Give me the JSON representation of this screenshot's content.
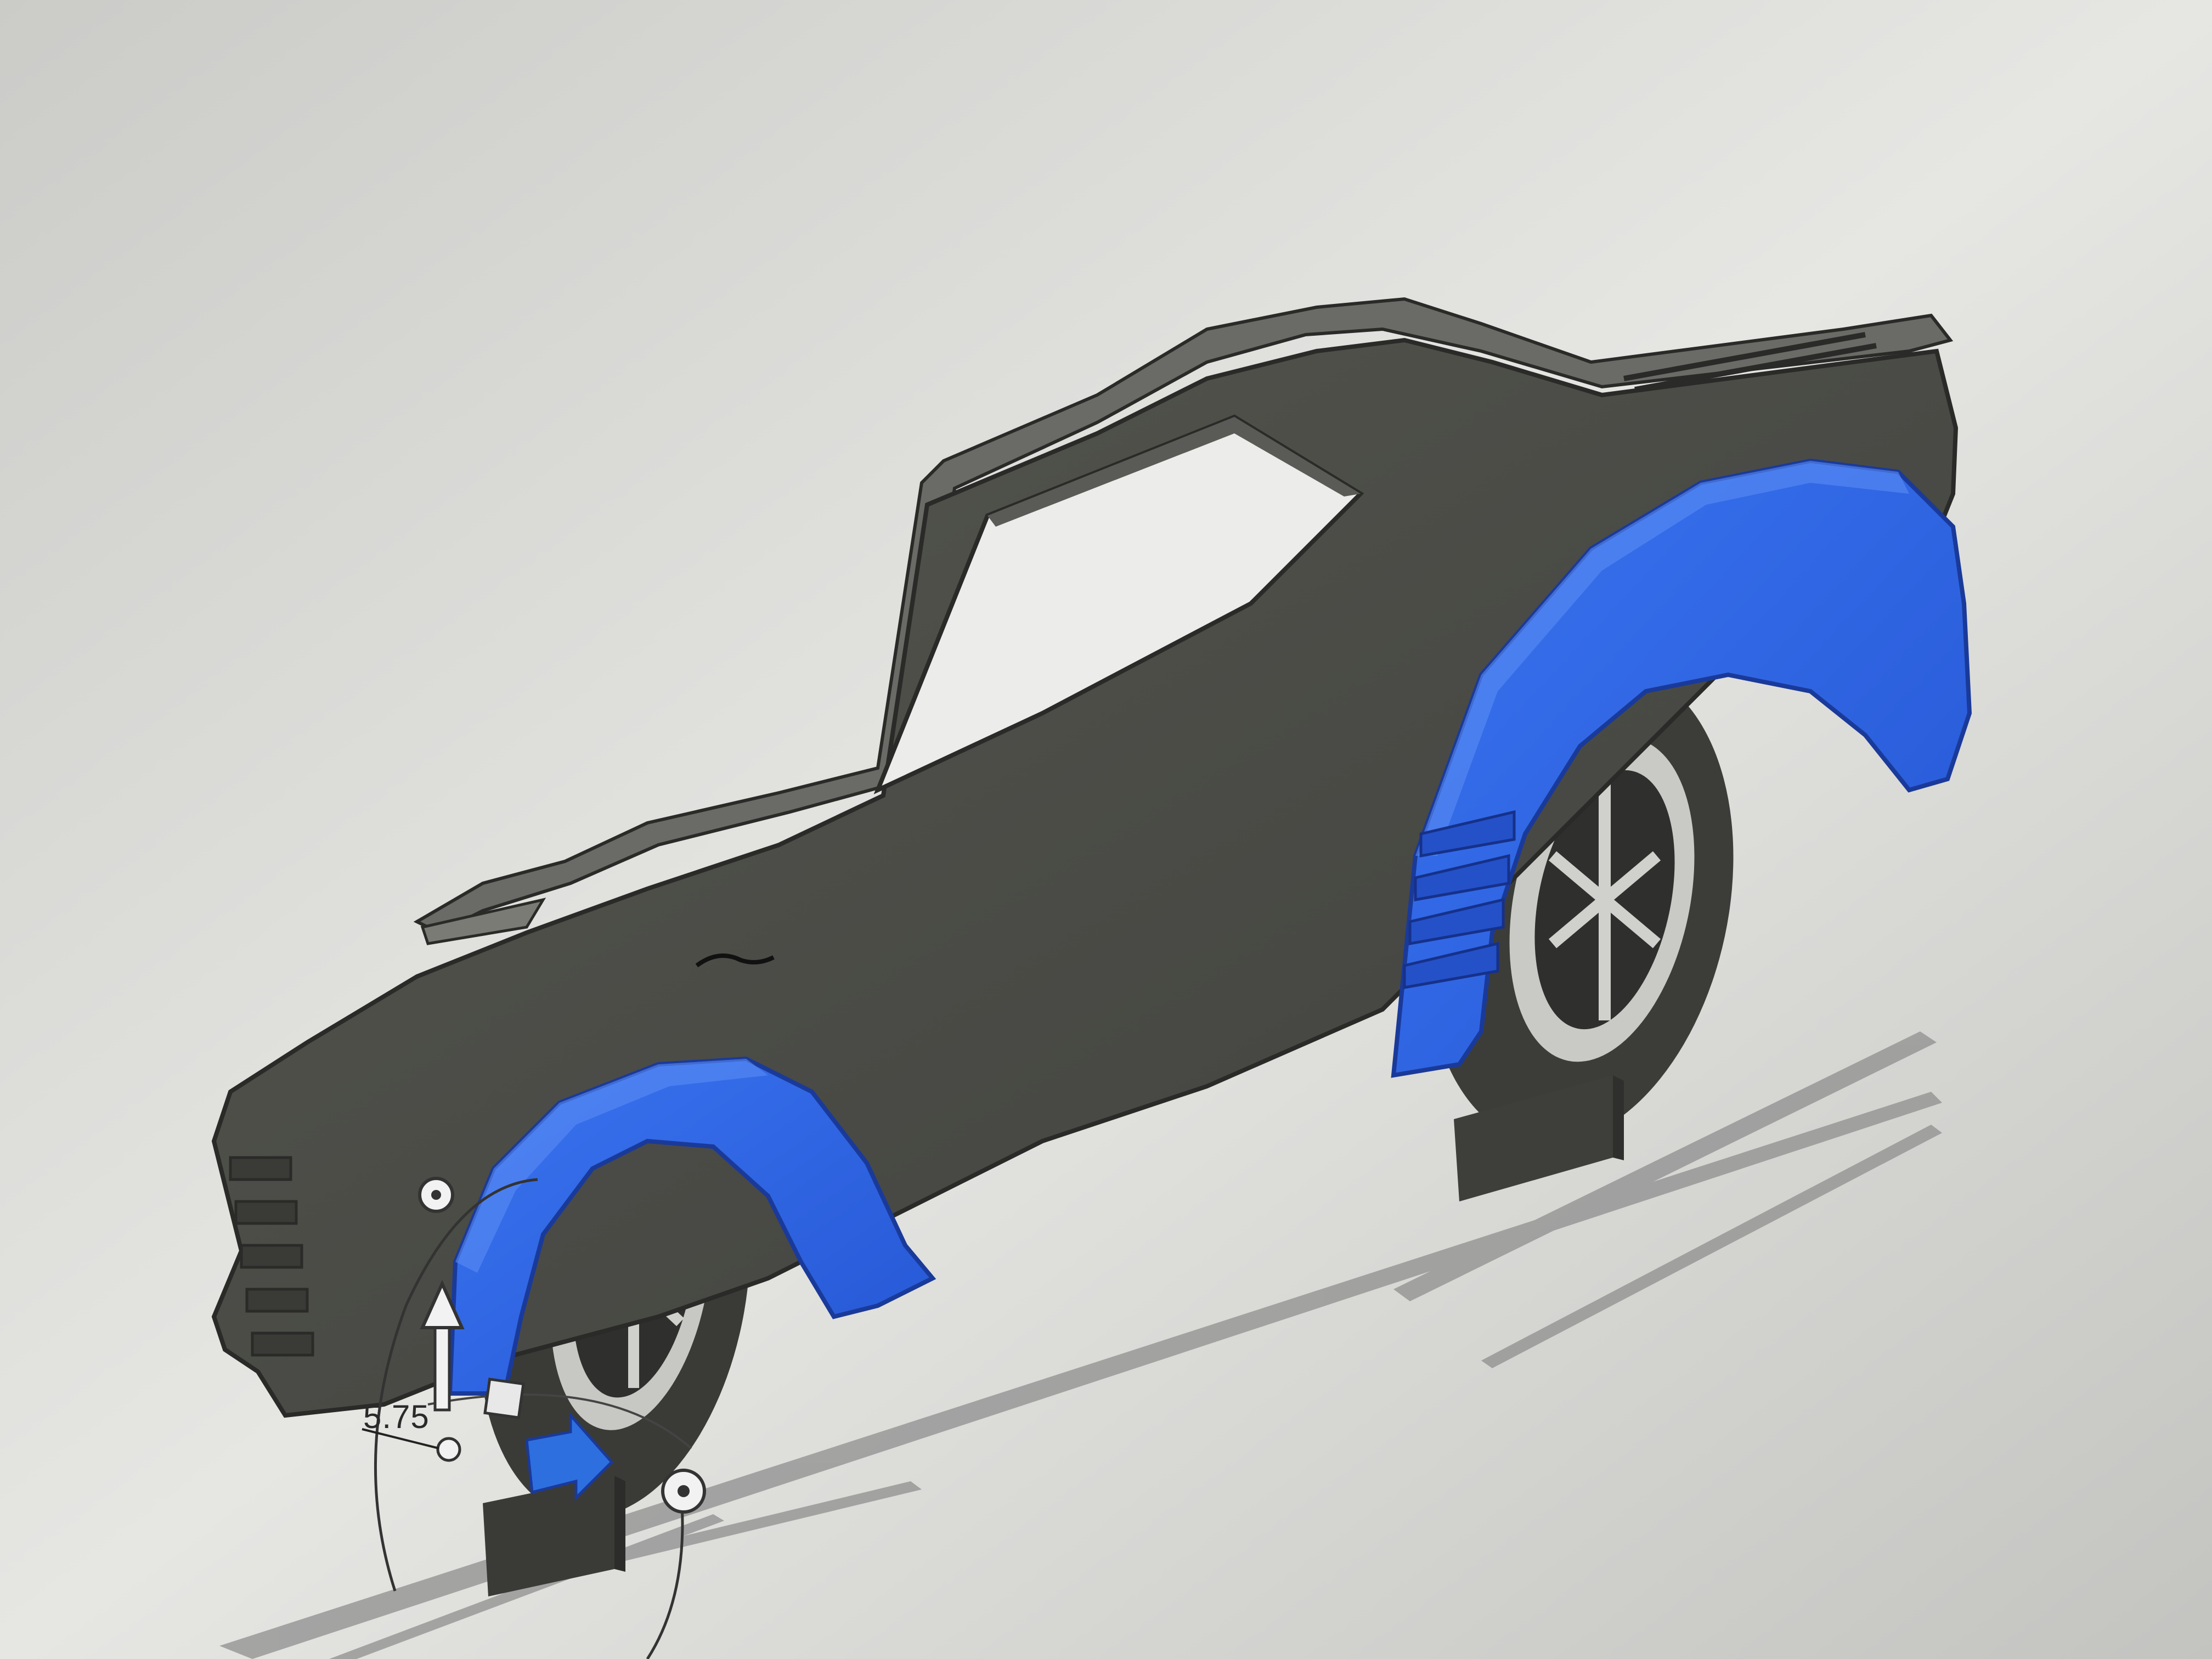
{
  "viewport": {
    "dimension_readout": "5.75"
  },
  "colors": {
    "background": "#d6d6d4",
    "body_dark": "#4a4b48",
    "body_edge": "#6f706c",
    "fender_blue": "#2f67e6",
    "fender_blue_dark": "#1f47b8",
    "ground_shadow": "#8f8f8f",
    "gizmo_arrow": "#2e6fe0",
    "gizmo_white": "#f2f2f2"
  },
  "icons": {
    "move_up_arrow": "arrow-up-icon",
    "move_right_arrow": "arrow-right-icon",
    "rotate_handle": "rotate-handle-icon",
    "plane_handle": "plane-handle-icon"
  }
}
